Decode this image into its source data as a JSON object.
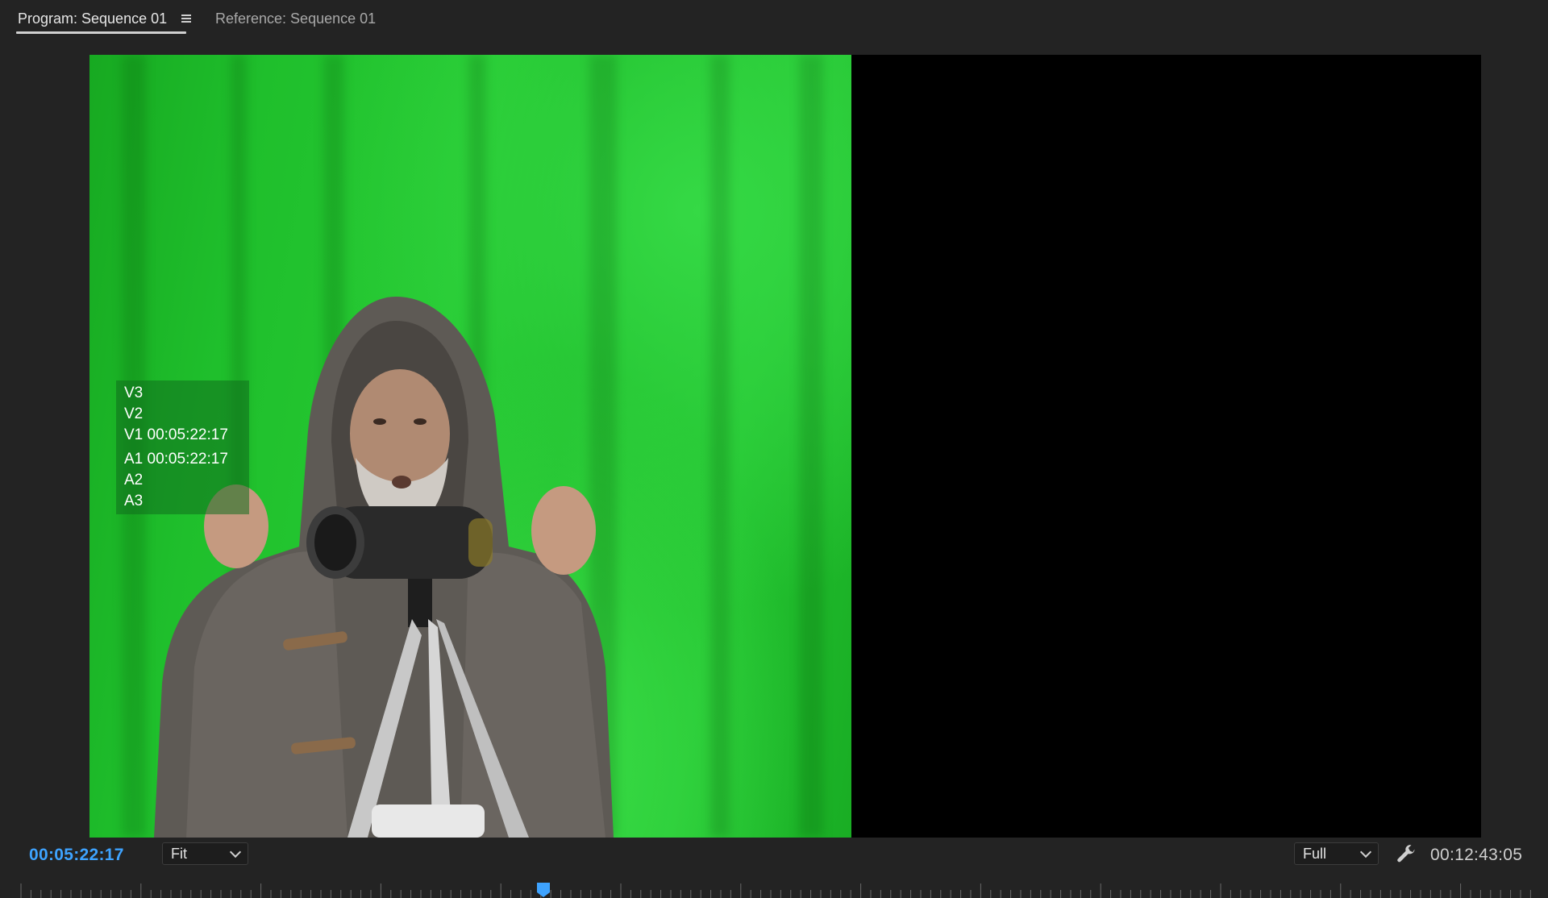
{
  "tabs": [
    {
      "label": "Program: Sequence 01",
      "active": true
    },
    {
      "label": "Reference: Sequence 01",
      "active": false
    }
  ],
  "overlay": {
    "video_lines": [
      "V3",
      "V2",
      "V1 00:05:22:17"
    ],
    "audio_lines": [
      "A1 00:05:22:17",
      "A2",
      "A3"
    ]
  },
  "controls": {
    "current_timecode": "00:05:22:17",
    "zoom_select": "Fit",
    "resolution_select": "Full",
    "duration_timecode": "00:12:43:05",
    "playhead_position": 0.347
  },
  "colors": {
    "timecode_accent": "#3ea3ff",
    "playhead": "#3ea3ff"
  },
  "icons": {
    "panel_menu": "hamburger-icon",
    "settings": "wrench-icon"
  }
}
